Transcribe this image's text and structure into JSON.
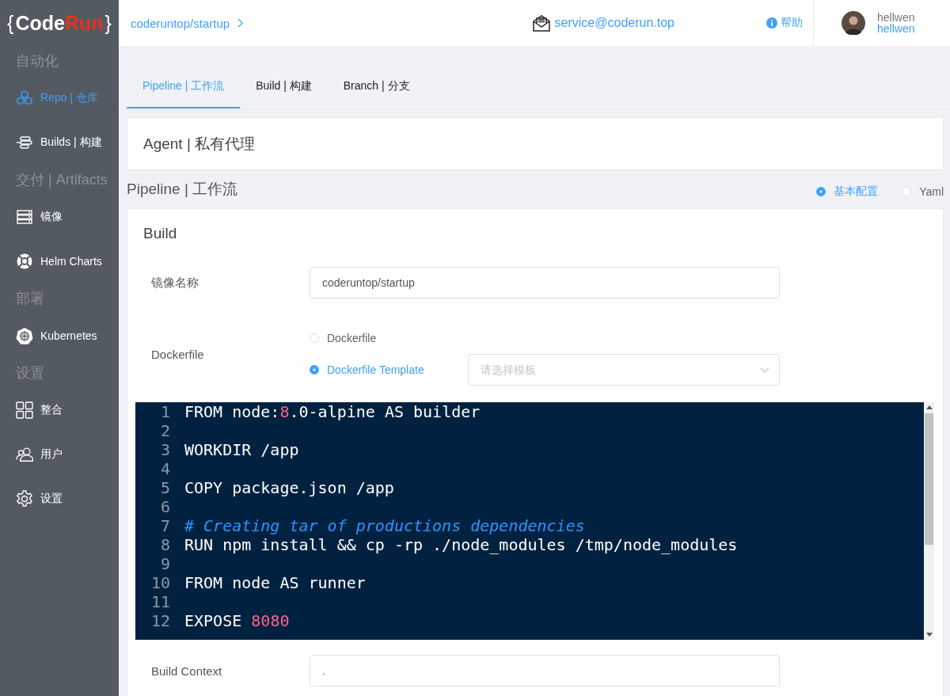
{
  "logo": {
    "open": "{",
    "code": "Code",
    "run": "Run",
    "close": "}"
  },
  "sidebar": {
    "items": [
      {
        "kind": "section",
        "label": "自动化"
      },
      {
        "kind": "item",
        "label": "Repo | 仓库",
        "selected": true
      },
      {
        "kind": "item",
        "label": "Builds | 构建",
        "selected": false
      },
      {
        "kind": "section",
        "label": "交付 | Artifacts"
      },
      {
        "kind": "item",
        "label": "镜像",
        "selected": false
      },
      {
        "kind": "item",
        "label": "Helm Charts",
        "selected": false
      },
      {
        "kind": "section",
        "label": "部署"
      },
      {
        "kind": "item",
        "label": "Kubernetes",
        "selected": false
      },
      {
        "kind": "section",
        "label": "设置"
      },
      {
        "kind": "item",
        "label": "整合",
        "selected": false
      },
      {
        "kind": "item",
        "label": "用户",
        "selected": false
      },
      {
        "kind": "item",
        "label": "设置",
        "selected": false
      }
    ]
  },
  "header": {
    "breadcrumb": "coderuntop/startup",
    "email": "service@coderun.top",
    "help": "帮助",
    "user": {
      "name": "hellwen",
      "link": "hellwen"
    }
  },
  "tabs": [
    {
      "label": "Pipeline | 工作流",
      "selected": true
    },
    {
      "label": "Build | 构建",
      "selected": false
    },
    {
      "label": "Branch | 分支",
      "selected": false
    }
  ],
  "agent_card": {
    "title": "Agent | 私有代理"
  },
  "pipeline": {
    "title": "Pipeline | 工作流",
    "modes": [
      {
        "label": "基本配置",
        "selected": true
      },
      {
        "label": "Yaml",
        "selected": false
      }
    ]
  },
  "build": {
    "title": "Build",
    "image_name": {
      "label": "镜像名称",
      "value": "coderuntop/startup"
    },
    "dockerfile": {
      "label": "Dockerfile",
      "options": [
        {
          "label": "Dockerfile",
          "selected": false
        },
        {
          "label": "Dockerfile Template",
          "selected": true
        }
      ],
      "template_placeholder": "请选择模板"
    },
    "editor": {
      "lines": [
        {
          "number": "1",
          "tokens": [
            {
              "kind": "plain",
              "text": "FROM node:"
            },
            {
              "kind": "number",
              "text": "8"
            },
            {
              "kind": "plain",
              "text": ".0-alpine AS builder"
            }
          ]
        },
        {
          "number": "2"
        },
        {
          "number": "3",
          "tokens": [
            {
              "kind": "plain",
              "text": "WORKDIR /app"
            }
          ]
        },
        {
          "number": "4"
        },
        {
          "number": "5",
          "tokens": [
            {
              "kind": "plain",
              "text": "COPY package.json /app"
            }
          ]
        },
        {
          "number": "6"
        },
        {
          "number": "7",
          "tokens": [
            {
              "kind": "comment",
              "text": "# Creating tar of productions dependencies"
            }
          ]
        },
        {
          "number": "8",
          "tokens": [
            {
              "kind": "plain",
              "text": "RUN npm install && cp -rp ./node_modules /tmp/node_modules"
            }
          ]
        },
        {
          "number": "9"
        },
        {
          "number": "10",
          "tokens": [
            {
              "kind": "plain",
              "text": "FROM node AS runner"
            }
          ]
        },
        {
          "number": "11"
        },
        {
          "number": "12",
          "tokens": [
            {
              "kind": "plain",
              "text": "EXPOSE "
            },
            {
              "kind": "number",
              "text": "8080"
            }
          ]
        }
      ]
    },
    "build_context": {
      "label": "Build Context",
      "value": "."
    }
  }
}
